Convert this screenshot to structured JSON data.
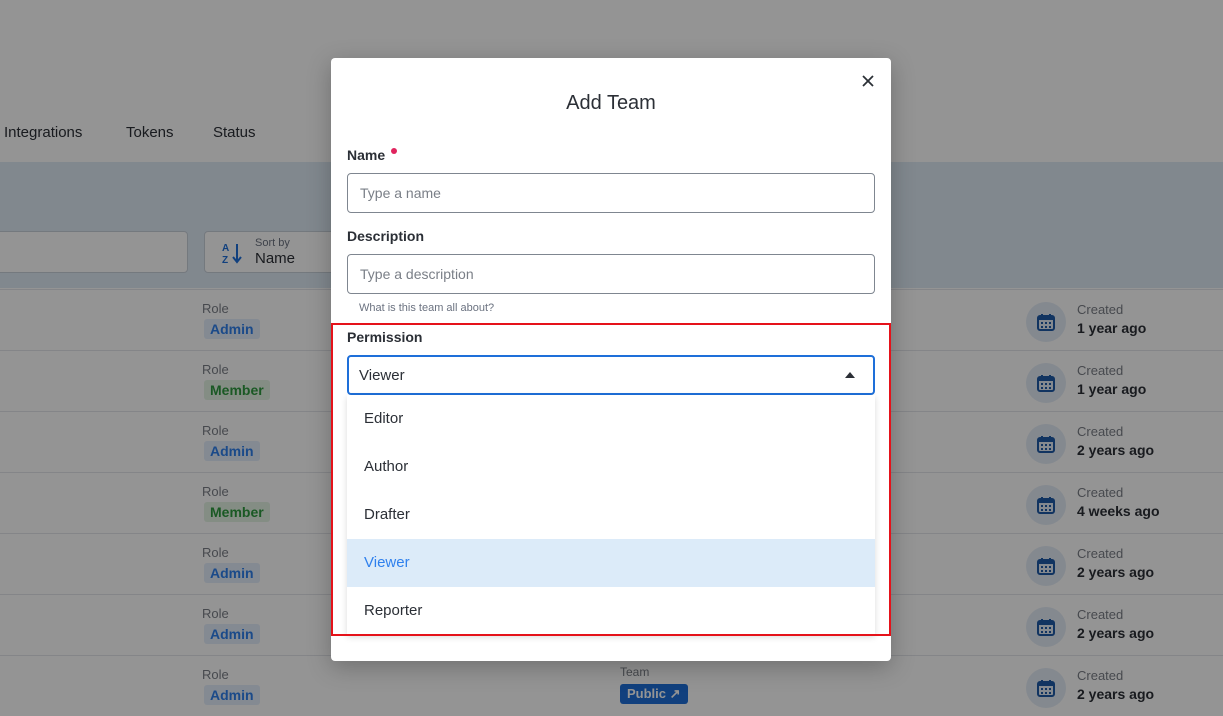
{
  "nav": {
    "tabs": [
      "Integrations",
      "Tokens",
      "Status"
    ]
  },
  "toolbar": {
    "sort_small_label": "Sort by",
    "sort_value": "Name"
  },
  "rows": [
    {
      "role_label": "Role",
      "role": "Admin",
      "role_type": "admin",
      "created_label": "Created",
      "created": "1 year ago"
    },
    {
      "role_label": "Role",
      "role": "Member",
      "role_type": "member",
      "created_label": "Created",
      "created": "1 year ago"
    },
    {
      "role_label": "Role",
      "role": "Admin",
      "role_type": "admin",
      "created_label": "Created",
      "created": "2 years ago"
    },
    {
      "role_label": "Role",
      "role": "Member",
      "role_type": "member",
      "created_label": "Created",
      "created": "4 weeks ago"
    },
    {
      "role_label": "Role",
      "role": "Admin",
      "role_type": "admin",
      "created_label": "Created",
      "created": "2 years ago"
    },
    {
      "role_label": "Role",
      "role": "Admin",
      "role_type": "admin",
      "created_label": "Created",
      "created": "2 years ago"
    },
    {
      "role_label": "Role",
      "role": "Admin",
      "role_type": "admin",
      "created_label": "Created",
      "created": "2 years ago",
      "team_label": "Team",
      "team": "Public ↗"
    }
  ],
  "modal": {
    "title": "Add Team",
    "close_icon": "close-icon",
    "name_label": "Name",
    "name_placeholder": "Type a name",
    "name_value": "",
    "description_label": "Description",
    "description_placeholder": "Type a description",
    "description_value": "",
    "description_helper": "What is this team all about?",
    "permission_label": "Permission",
    "permission_value": "Viewer",
    "permission_options": [
      "Editor",
      "Author",
      "Drafter",
      "Viewer",
      "Reporter"
    ]
  },
  "colors": {
    "accent": "#1e6fd9",
    "required": "#e0245e",
    "highlight": "#e5121a",
    "selected_bg": "#dcebf9"
  }
}
